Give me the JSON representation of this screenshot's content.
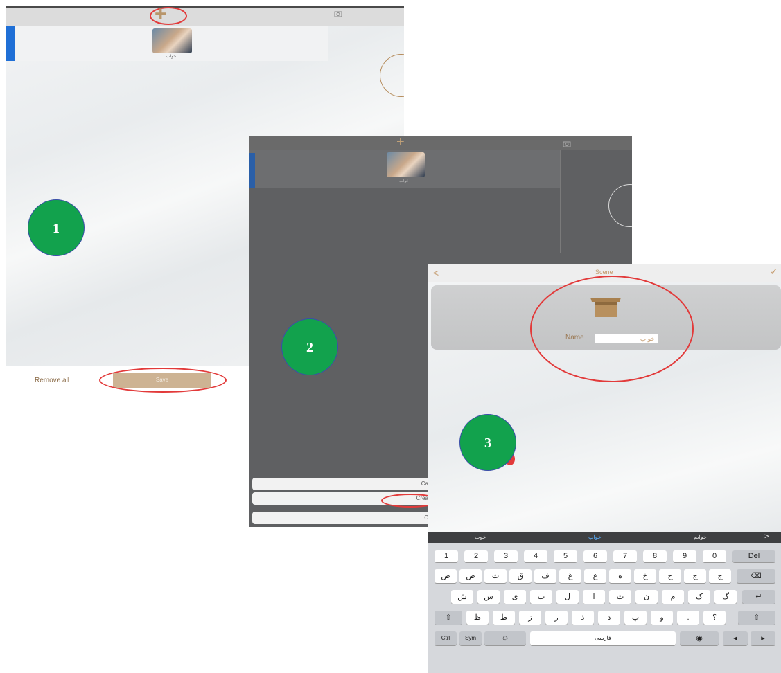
{
  "badges": [
    "1",
    "2",
    "3"
  ],
  "panel1": {
    "add_icon": "+",
    "camera_icon": "camera-icon",
    "room_label": "خواب",
    "remove_all_label": "Remove all",
    "save_label": "Save"
  },
  "panel2": {
    "add_icon": "+",
    "camera_icon": "camera-icon",
    "room_label": "خواب",
    "sheet_buttons": [
      "Ca",
      "Crea",
      "C"
    ]
  },
  "panel3": {
    "back_icon": "<",
    "title": "Scene",
    "confirm_icon": "✓",
    "name_label": "Name",
    "name_value": "خواب"
  },
  "keyboard": {
    "suggestions": [
      "خوب",
      "خواب",
      "خوابم"
    ],
    "suggest_arrow": ">",
    "row1": [
      "1",
      "2",
      "3",
      "4",
      "5",
      "6",
      "7",
      "8",
      "9",
      "0",
      "Del"
    ],
    "row2": [
      "ض",
      "ص",
      "ث",
      "ق",
      "ف",
      "غ",
      "ع",
      "ه",
      "خ",
      "ح",
      "ج",
      "چ",
      "⌫"
    ],
    "row3": [
      "ش",
      "س",
      "ی",
      "ب",
      "ل",
      "ا",
      "ت",
      "ن",
      "م",
      "ک",
      "گ",
      "↵"
    ],
    "row4": [
      "⇧",
      "ظ",
      "ط",
      "ز",
      "ر",
      "ذ",
      "د",
      "پ",
      "و",
      ".",
      "؟",
      "⇧"
    ],
    "row5": [
      "Ctrl",
      "Sym",
      "☺",
      "فارسی",
      "◉",
      "◂",
      "▸"
    ]
  },
  "colors": {
    "accent": "#c49a6c",
    "badge_green": "#12a24d",
    "highlight_red": "#e23a3a",
    "selection_blue": "#1f6fd6"
  }
}
